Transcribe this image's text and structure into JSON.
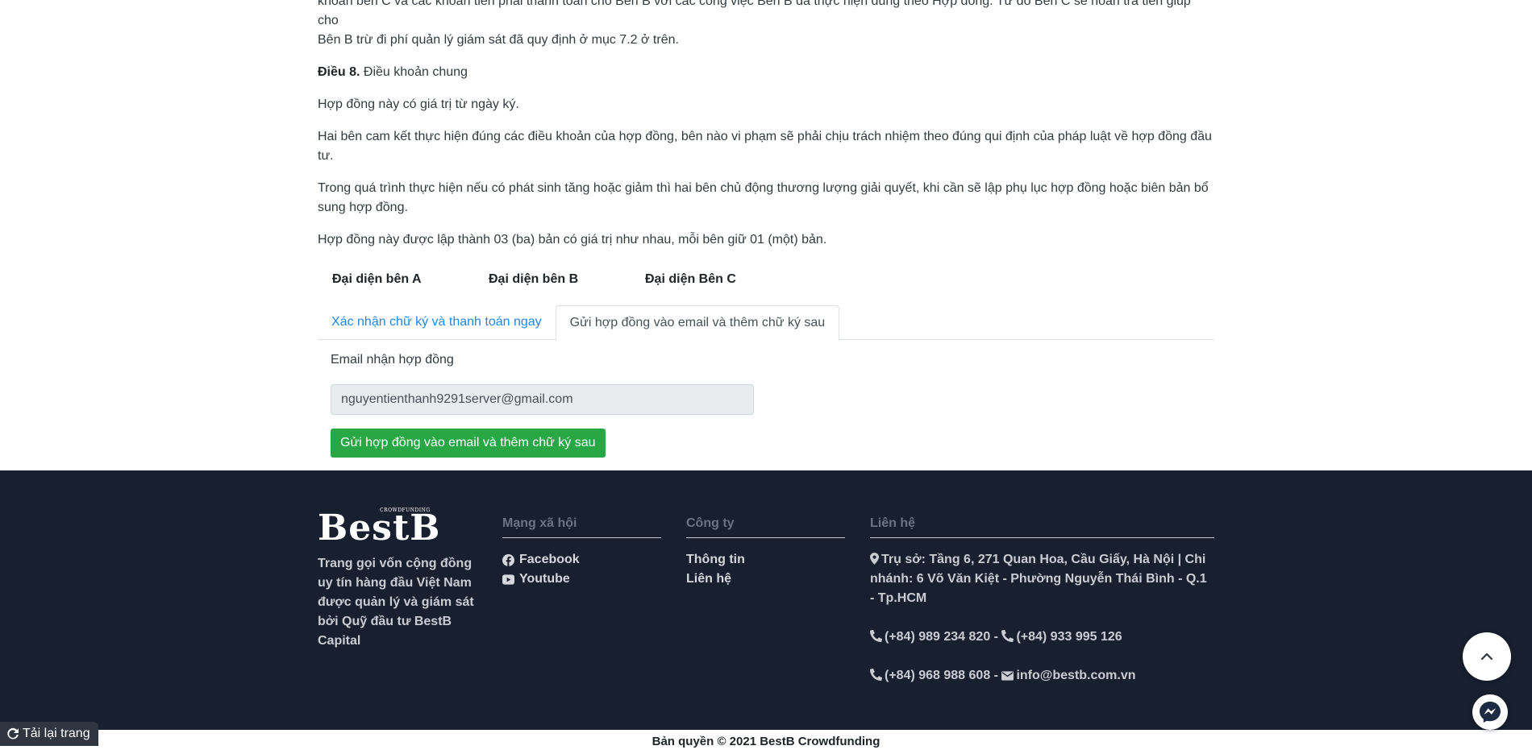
{
  "contract": {
    "para_cut_line1": "khoản bên C và các khoản tiền phải thanh toán cho Bên B với các công việc Bên B đã thực hiện đúng theo Hợp đồng. Từ đó Bên C sẽ hoàn trả tiền giúp cho",
    "para_cut_line2": "Bên B trừ đi phí quản lý giám sát đã quy định ở mục 7.2 ở trên.",
    "article8_label": "Điều 8.",
    "article8_title": "Điều khoản chung",
    "p1": "Hợp đồng này có giá trị từ ngày ký.",
    "p2": "Hai bên cam kết thực hiện đúng các điều khoản của hợp đồng, bên nào vi phạm sẽ phải chịu trách nhiệm theo đúng qui định của pháp luật về hợp đồng đầu tư.",
    "p3": "Trong quá trình thực hiện nếu có phát sinh tăng hoặc giảm thì hai bên chủ động thương lượng giải quyết, khi cần sẽ lập phụ lục hợp đồng hoặc biên bản bổ sung hợp đồng.",
    "p4": "Hợp đồng này được lập thành 03 (ba) bản có giá trị như nhau, mỗi bên giữ 01 (một) bản."
  },
  "signers": [
    "Đại diện bên A",
    "Đại diện bên B",
    "Đại diện Bên C"
  ],
  "tabs": {
    "confirm": "Xác nhận chữ ký và thanh toán ngay",
    "email": "Gửi hợp đồng vào email và thêm chữ ký sau"
  },
  "form": {
    "email_label": "Email nhận hợp đồng",
    "email_value": "nguyentienthanh9291server@gmail.com",
    "submit_label": "Gửi hợp đồng vào email và thêm chữ ký sau"
  },
  "footer": {
    "logo_small": "CROWDFUNDING",
    "logo_main": "BestB",
    "tagline": "Trang gọi vốn cộng đồng uy tín hàng đầu Việt Nam được quản lý và giám sát bởi Quỹ đầu tư BestB Capital",
    "social": {
      "title": "Mạng xã hội",
      "facebook": "Facebook",
      "youtube": "Youtube"
    },
    "company": {
      "title": "Công ty",
      "info": "Thông tin",
      "contact": "Liên hệ"
    },
    "contact": {
      "title": "Liên hệ",
      "address": "Trụ sở: Tầng 6, 271 Quan Hoa, Cầu Giấy, Hà Nội | Chi nhánh: 6 Võ Văn Kiệt - Phường Nguyễn Thái Bình - Q.1 - Tp.HCM",
      "phone1": "(+84) 989 234 820",
      "phone2": "(+84) 933 995 126",
      "phone3": "(+84) 968 988 608",
      "email": "info@bestb.com.vn",
      "sep": " - "
    },
    "copyright": "Bản quyền © 2021 BestB Crowdfunding"
  },
  "reload_label": "Tải lại trang",
  "icons": {
    "facebook": "facebook-icon",
    "youtube": "youtube-icon",
    "map_marker": "map-marker-icon",
    "phone": "phone-icon",
    "envelope": "envelope-icon",
    "scroll_top": "chevron-up-icon",
    "messenger": "messenger-icon",
    "reload": "reload-icon"
  },
  "colors": {
    "footer_bg": "#181f2e",
    "accent_link": "#1e88e5",
    "success": "#28a745",
    "messenger_blue": "#0a7cff"
  }
}
